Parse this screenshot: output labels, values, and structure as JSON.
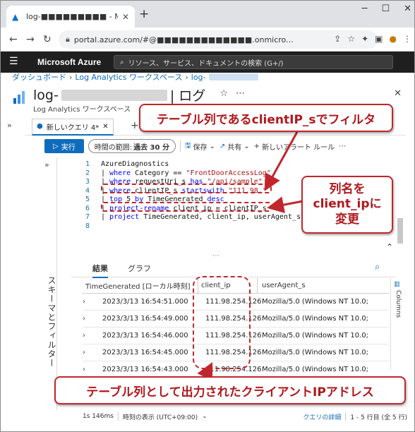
{
  "browser": {
    "tab_title": "log-■■■■■■■■■ - Micr",
    "url": "portal.azure.com/#@■■■■■■■■■■■■■.onmicro..."
  },
  "azure": {
    "brand": "Microsoft Azure",
    "search_placeholder": "リソース、サービス、ドキュメントの検索 (G+/)"
  },
  "breadcrumb": [
    "ダッシュボード",
    "Log Analytics ワークスペース",
    "log-"
  ],
  "header": {
    "title_prefix": "log-",
    "title_suffix": "| ログ",
    "subtitle": "Log Analytics ワークスペース"
  },
  "query_tab": {
    "label": "新しいクエリ 4*"
  },
  "toolbar": {
    "run": "実行",
    "time_range_label": "時間の範囲:",
    "time_range_value": "過去 30 分",
    "save": "保存",
    "share": "共有",
    "new_alert": "新しいアラート ルール"
  },
  "schema_panel": {
    "label": "スキーマとフィルター"
  },
  "editor": {
    "lines": [
      {
        "n": "1",
        "text": "AzureDiagnostics"
      },
      {
        "n": "2",
        "text": "| where Category == \"FrontDoorAccessLog\""
      },
      {
        "n": "3",
        "text": "| where requestUri_s has \"/api/sample\""
      },
      {
        "n": "4",
        "text": "| where clientIP_s startswith \"111.98.\""
      },
      {
        "n": "5",
        "text": "| top 5 by TimeGenerated desc"
      },
      {
        "n": "6",
        "text": "| project-rename client_ip = clientIP_s"
      },
      {
        "n": "7",
        "text": "| project TimeGenerated, client_ip, userAgent_s"
      },
      {
        "n": "8",
        "text": ""
      }
    ]
  },
  "results": {
    "tabs": [
      "結果",
      "グラフ"
    ],
    "columns": [
      "TimeGenerated [ローカル時刻]",
      "client_ip",
      "userAgent_s"
    ],
    "rows": [
      [
        "2023/3/13 16:54:51.000",
        "111.98.254.126",
        "Mozilla/5.0 (Windows NT 10.0;"
      ],
      [
        "2023/3/13 16:54:49.000",
        "111.98.254.126",
        "Mozilla/5.0 (Windows NT 10.0;"
      ],
      [
        "2023/3/13 16:54:46.000",
        "111.98.254.126",
        "Mozilla/5.0 (Windows NT 10.0;"
      ],
      [
        "2023/3/13 16:54:45.000",
        "111.98.254.126",
        "Mozilla/5.0 (Windows NT 10.0;"
      ],
      [
        "2023/3/13 16:54:43.000",
        "111.98.254.126",
        "Mozilla/5.0 (Windows NT 10.0;"
      ]
    ],
    "columns_panel": "Columns"
  },
  "status": {
    "duration": "1s 146ms",
    "time_display": "時刻の表示 (UTC+09:00)",
    "query_details": "クエリの詳細",
    "rows_info": "1 - 5 行目 (全 5 行)"
  },
  "annotations": {
    "callout1": "テーブル列であるclientIP_sでフィルタ",
    "callout2_line1": "列名を",
    "callout2_line2": "client_ipに",
    "callout2_line3": "変更",
    "callout3": "テーブル列として出力されたクライアントIPアドレス"
  },
  "colors": {
    "accent": "#0f6cbd",
    "annotation": "#c0272d",
    "azure_bar": "#1f1f1f"
  }
}
